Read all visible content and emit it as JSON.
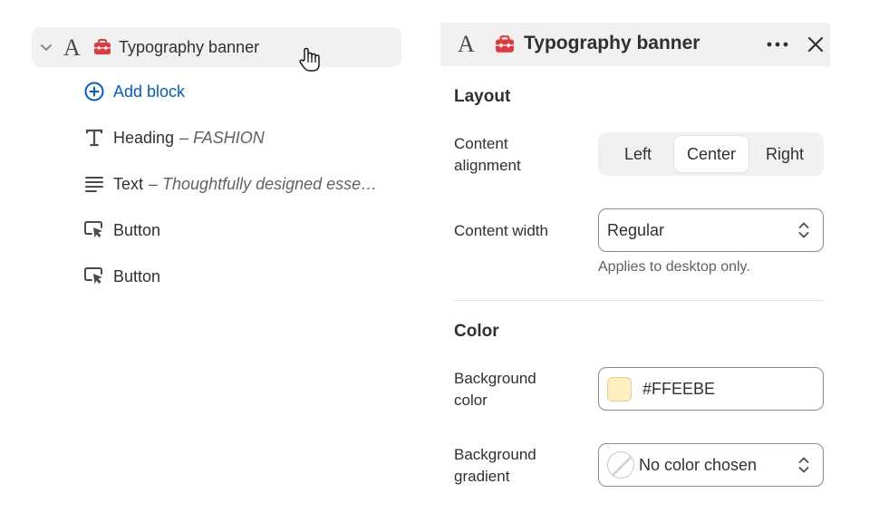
{
  "tree": {
    "header_title": "Typography banner",
    "items": [
      {
        "label": "Add block",
        "icon": "plus-circle-icon"
      },
      {
        "label": "Heading",
        "sub": "– FASHION",
        "icon": "text-type-icon"
      },
      {
        "label": "Text",
        "sub": "– Thoughtfully designed esse…",
        "icon": "paragraph-lines-icon"
      },
      {
        "label": "Button",
        "icon": "button-cursor-icon"
      },
      {
        "label": "Button",
        "icon": "button-cursor-icon"
      }
    ]
  },
  "panel": {
    "title": "Typography banner",
    "layout": {
      "section": "Layout",
      "content_alignment_label": "Content alignment",
      "alignment_options": [
        "Left",
        "Center",
        "Right"
      ],
      "alignment_selected": "Center",
      "content_width_label": "Content width",
      "content_width_value": "Regular",
      "content_width_help": "Applies to desktop only."
    },
    "color": {
      "section": "Color",
      "background_color_label": "Background color",
      "background_color_value": "#FFEEBE",
      "background_gradient_label": "Background gradient",
      "background_gradient_value": "No color chosen"
    }
  },
  "colors": {
    "accent_link": "#005bd3",
    "swatch": "#FFEEBE",
    "toolbox_red": "#e0393e",
    "hover_bg": "#f1f1f1"
  }
}
